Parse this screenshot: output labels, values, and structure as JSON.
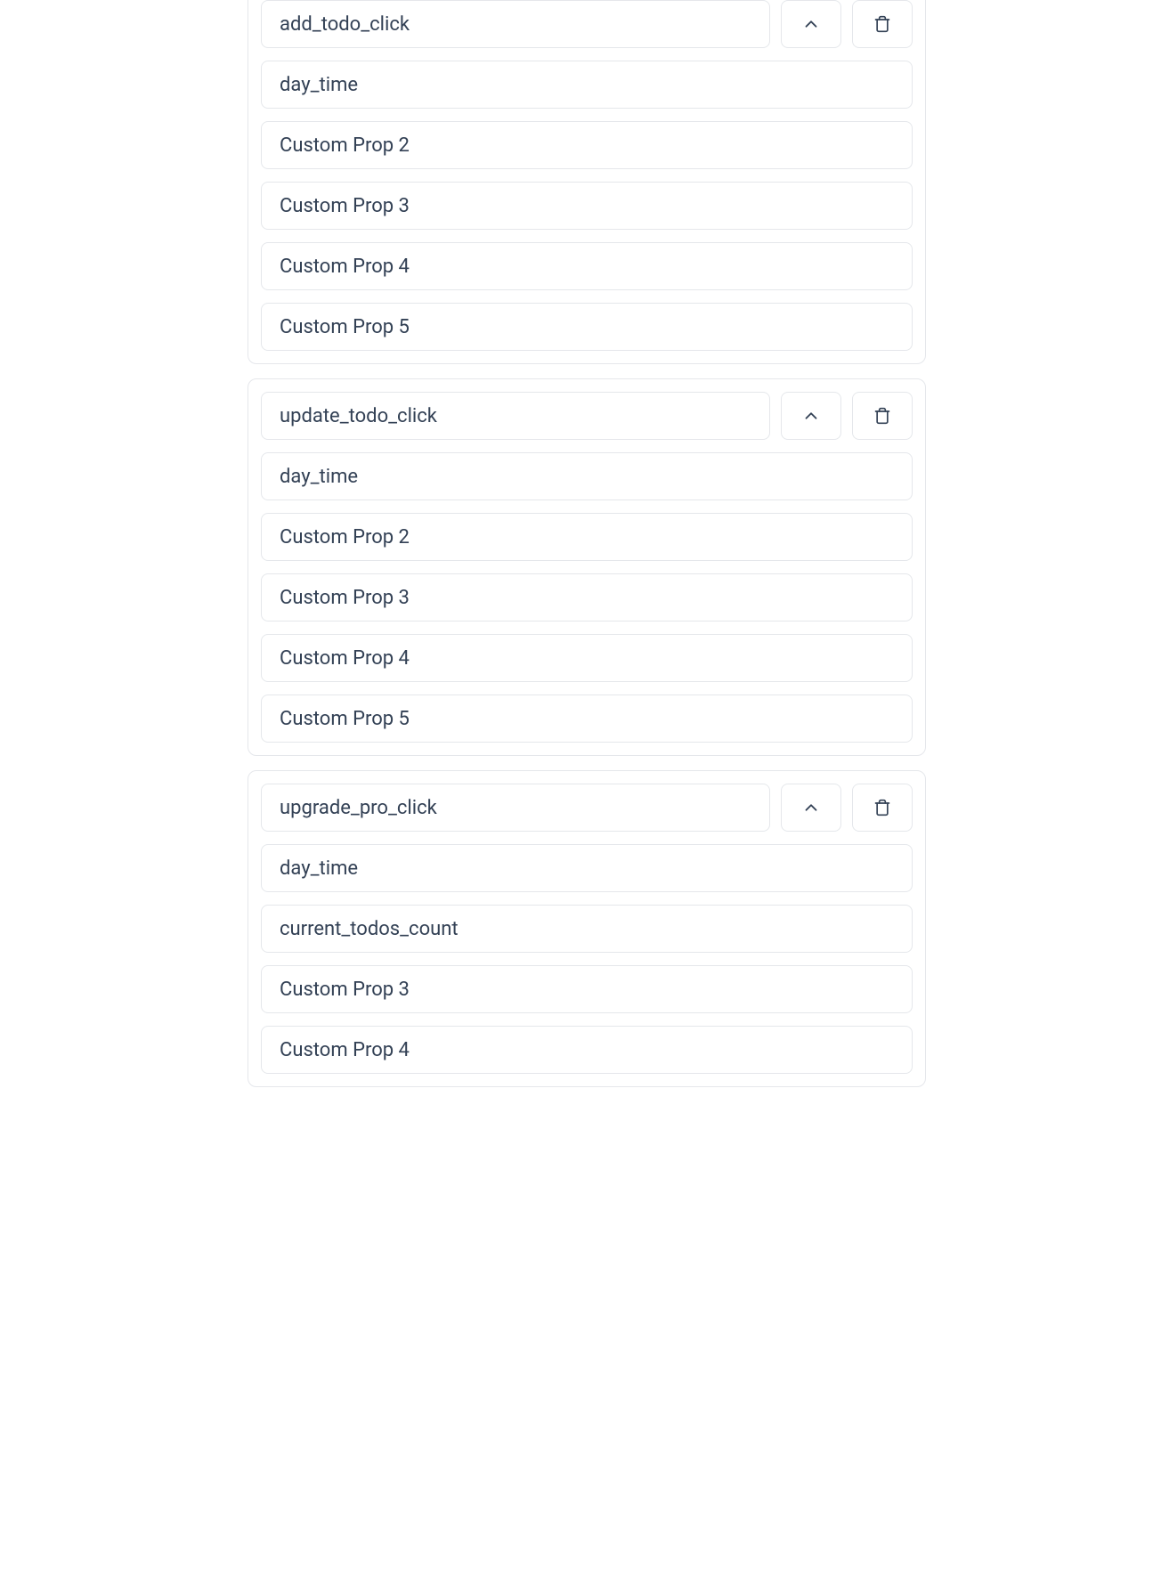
{
  "events": [
    {
      "name": "add_todo_click",
      "props": [
        "day_time",
        "Custom Prop 2",
        "Custom Prop 3",
        "Custom Prop 4",
        "Custom Prop 5"
      ],
      "cutoffTop": true
    },
    {
      "name": "update_todo_click",
      "props": [
        "day_time",
        "Custom Prop 2",
        "Custom Prop 3",
        "Custom Prop 4",
        "Custom Prop 5"
      ],
      "cutoffTop": false
    },
    {
      "name": "upgrade_pro_click",
      "props": [
        "day_time",
        "current_todos_count",
        "Custom Prop 3",
        "Custom Prop 4"
      ],
      "cutoffTop": false
    }
  ]
}
